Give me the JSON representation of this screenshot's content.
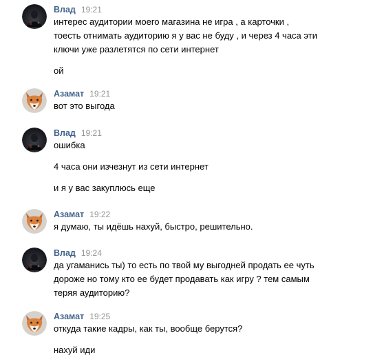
{
  "colors": {
    "author": "#42648b",
    "time": "#939393",
    "text": "#000000",
    "background": "#ffffff"
  },
  "messages": [
    {
      "author": "Влад",
      "time": "19:21",
      "avatar": "dark-avatar",
      "paragraphs": [
        [
          "интерес аудитории моего магазина не игра , а карточки ,",
          "тоесть отнимать аудиторию я у вас не буду , и через 4 часа эти",
          "ключи уже разлетятся по сети интернет"
        ],
        [
          "ой"
        ]
      ]
    },
    {
      "author": "Азамат",
      "time": "19:21",
      "avatar": "fox-avatar",
      "paragraphs": [
        [
          "вот это выгода"
        ]
      ]
    },
    {
      "author": "Влад",
      "time": "19:21",
      "avatar": "dark-avatar",
      "paragraphs": [
        [
          "ошибка"
        ],
        [
          "4 часа они изчезнут из сети интернет"
        ],
        [
          "и я у вас закуплюсь еще"
        ]
      ]
    },
    {
      "author": "Азамат",
      "time": "19:22",
      "avatar": "fox-avatar",
      "paragraphs": [
        [
          "я думаю, ты идёшь нахуй, быстро, решительно."
        ]
      ]
    },
    {
      "author": "Влад",
      "time": "19:24",
      "avatar": "dark-avatar",
      "paragraphs": [
        [
          "да угаманись ты) то есть по твой му выгодней продать ее чуть",
          "дороже но тому кто ее будет продавать как игру ? тем самым",
          "теряя аудиторию?"
        ]
      ]
    },
    {
      "author": "Азамат",
      "time": "19:25",
      "avatar": "fox-avatar",
      "paragraphs": [
        [
          "откуда такие кадры, как ты, вообще берутся?"
        ],
        [
          "нахуй иди"
        ]
      ]
    }
  ]
}
